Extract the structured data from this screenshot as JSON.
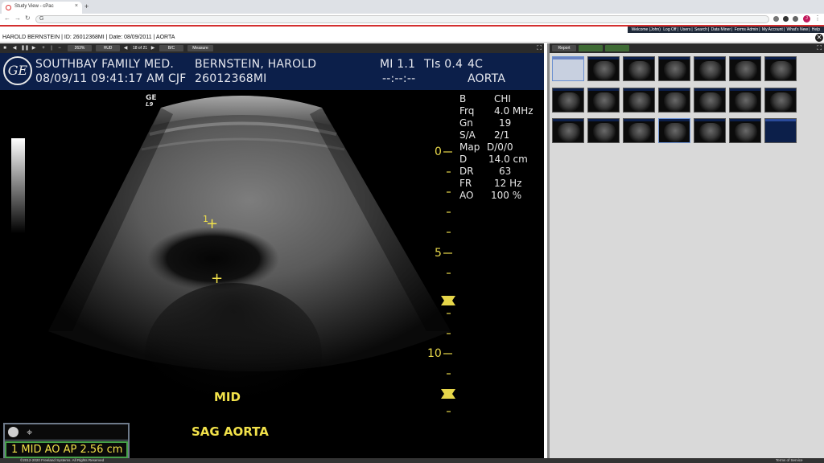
{
  "browser": {
    "tab_title": "Study View - cPac",
    "tab_close": "×",
    "new_tab": "+",
    "address_prefix": "G",
    "address_value": "",
    "profile_initial": "J"
  },
  "app": {
    "userbar": {
      "welcome": "Welcome (John)",
      "links": [
        "Log Off",
        "Users",
        "Search",
        "Data Miner",
        "Forms Admin",
        "My Account",
        "What's New",
        "Help"
      ]
    },
    "patient_bar": "HAROLD BERNSTEIN | ID: 26012368MI | Date: 08/09/2011 | AORTA"
  },
  "viewer_toolbar": {
    "zoom": "263%",
    "hud": "HUD",
    "frame_counter": "18 of 21",
    "bc": "B/C",
    "measure": "Measure"
  },
  "ultrasound": {
    "logo": "GE",
    "institution": "SOUTHBAY FAMILY MED.",
    "datetime": "08/09/11 09:41:17 AM CJF",
    "patient_name": "BERNSTEIN, HAROLD",
    "patient_id": "26012368MI",
    "mi": "MI 1.1",
    "tis": "TIs 0.4",
    "time_placeholder": "--:--:--",
    "probe_code": "4C",
    "exam": "AORTA",
    "probe_badge_top": "GE",
    "probe_badge_bottom": "L9",
    "params": [
      {
        "label": "B",
        "value": "CHI"
      },
      {
        "label": "Frq",
        "value": "4.0 MHz"
      },
      {
        "label": "Gn",
        "value": "19"
      },
      {
        "label": "S/A",
        "value": "2/1"
      },
      {
        "label": "Map",
        "value": "D/0/0"
      },
      {
        "label": "D",
        "value": "14.0 cm"
      },
      {
        "label": "DR",
        "value": "63"
      },
      {
        "label": "FR",
        "value": "12 Hz"
      },
      {
        "label": "AO",
        "value": "100 %"
      }
    ],
    "depth_labels": [
      "0",
      "5",
      "10"
    ],
    "caliper_index": "1",
    "annotation_1": "MID",
    "annotation_2": "SAG AORTA",
    "measurement": "1 MID AO AP  2.56 cm"
  },
  "side_panel": {
    "report": "Report",
    "btn2": "",
    "btn3": ""
  },
  "footer": {
    "copyright": "©2012-2020 Freeland Systems. All Rights Reserved",
    "terms": "Terms of Service"
  }
}
